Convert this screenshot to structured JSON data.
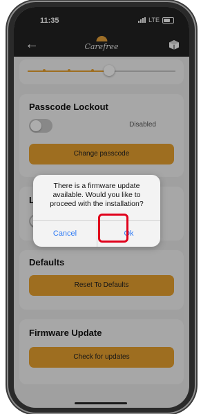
{
  "status_bar": {
    "time": "11:35",
    "network": "LTE"
  },
  "nav": {
    "back_icon": "back-arrow-icon",
    "logo_text": "Carefree",
    "cube_icon": "cube-icon"
  },
  "brightness_slider": {
    "value_fraction": 0.55
  },
  "passcode_section": {
    "title": "Passcode Lockout",
    "toggle_state": "Disabled",
    "button_label": "Change passcode"
  },
  "led_section": {
    "title": "LED"
  },
  "defaults_section": {
    "title": "Defaults",
    "button_label": "Reset To Defaults"
  },
  "firmware_section": {
    "title": "Firmware Update",
    "button_label": "Check for updates"
  },
  "dialog": {
    "message": "There is a firmware update available. Would you like to proceed with the installation?",
    "cancel_label": "Cancel",
    "ok_label": "Ok"
  },
  "colors": {
    "accent": "#e9a230",
    "dialog_link": "#2f7bf5",
    "highlight": "#e0001b"
  }
}
